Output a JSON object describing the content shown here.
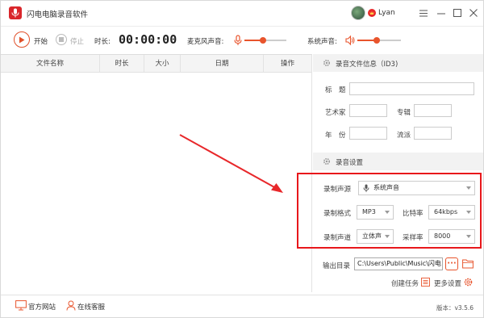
{
  "app": {
    "title": "闪电电脑录音软件",
    "user_name": "Lyan"
  },
  "toolbar": {
    "start_label": "开始",
    "stop_label": "停止",
    "duration_label": "时长:",
    "duration_value": "00:00:00",
    "mic_label": "麦克风声音:",
    "system_label": "系统声音:",
    "mic_level": 0.45,
    "system_level": 0.45
  },
  "table": {
    "columns": [
      "文件名称",
      "时长",
      "大小",
      "日期",
      "操作"
    ],
    "rows": []
  },
  "id3": {
    "section_title": "录音文件信息（ID3)",
    "title_label": "标　题",
    "artist_label": "艺术家",
    "album_label": "专辑",
    "year_label": "年　份",
    "genre_label": "流派"
  },
  "settings": {
    "section_title": "录音设置",
    "source_label": "录制声源",
    "source_value": "系统声音",
    "format_label": "录制格式",
    "format_value": "MP3",
    "bitrate_label": "比特率",
    "bitrate_value": "64kbps",
    "channel_label": "录制声道",
    "channel_value": "立体声",
    "samplerate_label": "采样率",
    "samplerate_value": "8000",
    "output_label": "输出目录",
    "output_path": "C:\\Users\\Public\\Music\\闪电",
    "more_button": "···",
    "create_task": "创建任务",
    "more_settings": "更多设置"
  },
  "status": {
    "website": "官方网站",
    "support": "在线客服",
    "version": "版本：v3.5.6"
  },
  "colors": {
    "accent": "#e8542c",
    "highlight": "#e8171b",
    "arrow": "#e8272a"
  }
}
